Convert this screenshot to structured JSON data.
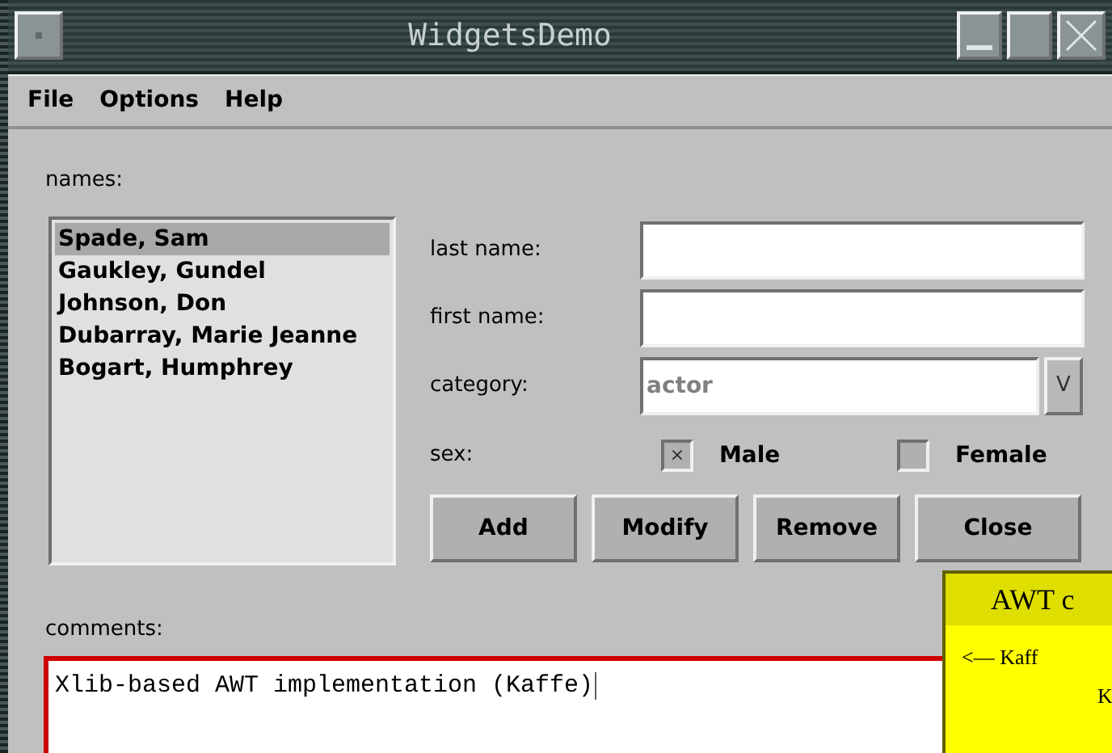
{
  "window": {
    "title": "WidgetsDemo"
  },
  "menu": [
    "File",
    "Options",
    "Help"
  ],
  "names_label": "names:",
  "names": [
    {
      "text": "Spade, Sam",
      "selected": true
    },
    {
      "text": "Gaukley, Gundel",
      "selected": false
    },
    {
      "text": "Johnson, Don",
      "selected": false
    },
    {
      "text": "Dubarray, Marie Jeanne",
      "selected": false
    },
    {
      "text": "Bogart, Humphrey",
      "selected": false
    }
  ],
  "fields": [
    {
      "label": "last name:"
    },
    {
      "label": "first name:"
    }
  ],
  "category": {
    "label": "category:",
    "value": "actor",
    "button": "V"
  },
  "sex": {
    "label": "sex:",
    "mark": "×",
    "options": [
      {
        "label": "Male",
        "checked": true
      },
      {
        "label": "Female",
        "checked": false
      }
    ]
  },
  "buttons": [
    "Add",
    "Modify",
    "Remove",
    "Close"
  ],
  "comments": {
    "label": "comments:",
    "value": "Xlib-based AWT implementation (Kaffe)"
  },
  "popup": {
    "title": "AWT c",
    "lines": [
      "<— Kaff",
      "K"
    ]
  }
}
